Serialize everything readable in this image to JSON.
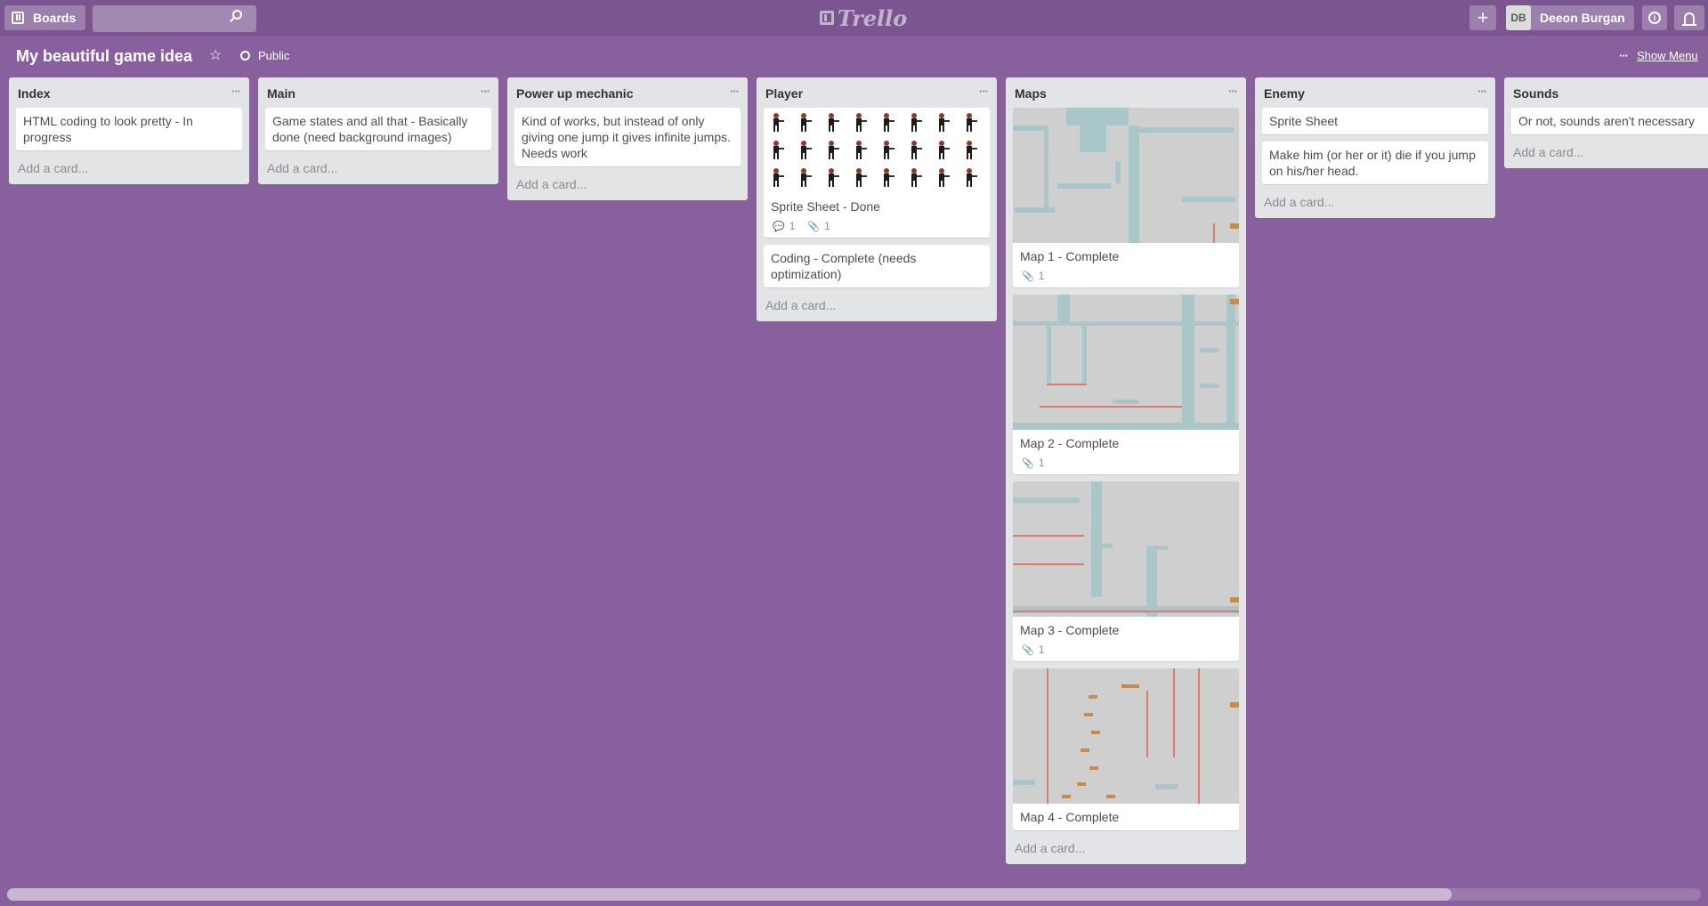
{
  "header": {
    "boards_label": "Boards",
    "search_placeholder": "",
    "logo_text": "Trello",
    "plus_label": "+",
    "user": {
      "initials": "DB",
      "name": "Deeon Burgan"
    },
    "info_label": "i"
  },
  "board": {
    "title": "My beautiful game idea",
    "visibility": "Public",
    "show_menu": "Show Menu",
    "background_color": "#89609e"
  },
  "add_card_label": "Add a card...",
  "lists": [
    {
      "title": "Index",
      "cards": [
        {
          "text": "HTML coding to look pretty - In progress"
        }
      ]
    },
    {
      "title": "Main",
      "cards": [
        {
          "text": "Game states and all that - Basically done (need background images)"
        }
      ]
    },
    {
      "title": "Power up mechanic",
      "cards": [
        {
          "text": "Kind of works, but instead of only giving one jump it gives infinite jumps. Needs work"
        }
      ]
    },
    {
      "title": "Player",
      "cards": [
        {
          "text": "Sprite Sheet - Done",
          "cover": "sprite-sheet",
          "comments": "1",
          "attachments": "1"
        },
        {
          "text": "Coding - Complete (needs optimization)"
        }
      ]
    },
    {
      "title": "Maps",
      "cards": [
        {
          "text": "Map 1 - Complete",
          "cover": "map",
          "attachments": "1"
        },
        {
          "text": "Map 2 - Complete",
          "cover": "map",
          "attachments": "1"
        },
        {
          "text": "Map 3 - Complete",
          "cover": "map",
          "attachments": "1"
        },
        {
          "text": "Map 4 - Complete",
          "cover": "map"
        }
      ]
    },
    {
      "title": "Enemy",
      "cards": [
        {
          "text": "Sprite Sheet"
        },
        {
          "text": "Make him (or her or it) die if you jump on his/her head."
        }
      ]
    },
    {
      "title": "Sounds",
      "cards": [
        {
          "text": "Or not, sounds aren't necessary"
        }
      ]
    }
  ]
}
